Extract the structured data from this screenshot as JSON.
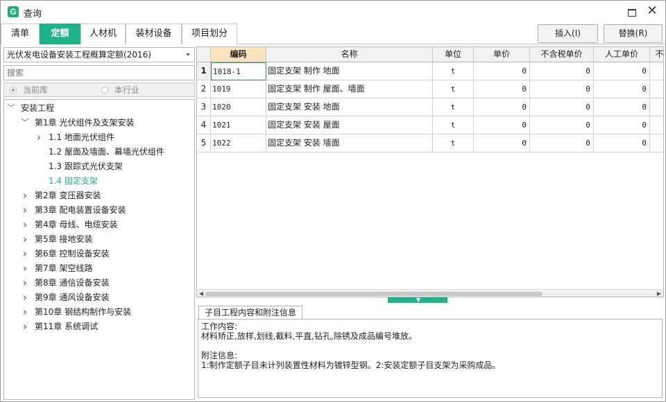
{
  "window": {
    "title": "查询",
    "app_icon_letter": "G"
  },
  "tabs": [
    {
      "label": "清单",
      "active": false
    },
    {
      "label": "定额",
      "active": true
    },
    {
      "label": "人材机",
      "active": false
    },
    {
      "label": "装材设备",
      "active": false
    },
    {
      "label": "项目划分",
      "active": false
    }
  ],
  "toolbar": {
    "insert_label": "插入(I)",
    "replace_label": "替换(R)"
  },
  "left": {
    "library_select": "光伏发电设备安装工程概算定额(2016)",
    "search_placeholder": "搜索",
    "radio_current": "当前库",
    "radio_industry": "本行业"
  },
  "tree": [
    {
      "label": "安装工程",
      "level": 0,
      "chevron": "v",
      "selected": false
    },
    {
      "label": "第1章  光伏组件及支架安装",
      "level": 1,
      "chevron": "v",
      "selected": false
    },
    {
      "label": "1.1 地面光伏组件",
      "level": 2,
      "chevron": ">",
      "selected": false
    },
    {
      "label": "1.2 屋面及墙面、幕墙光伏组件",
      "level": 2,
      "chevron": "",
      "selected": false
    },
    {
      "label": "1.3 跟踪式光伏支架",
      "level": 2,
      "chevron": "",
      "selected": false
    },
    {
      "label": "1.4 固定支架",
      "level": 2,
      "chevron": "",
      "selected": true
    },
    {
      "label": "第2章  变压器安装",
      "level": 1,
      "chevron": ">",
      "selected": false
    },
    {
      "label": "第3章  配电装置设备安装",
      "level": 1,
      "chevron": ">",
      "selected": false
    },
    {
      "label": "第4章  母线、电缆安装",
      "level": 1,
      "chevron": ">",
      "selected": false
    },
    {
      "label": "第5章  接地安装",
      "level": 1,
      "chevron": ">",
      "selected": false
    },
    {
      "label": "第6章  控制设备安装",
      "level": 1,
      "chevron": ">",
      "selected": false
    },
    {
      "label": "第7章  架空线路",
      "level": 1,
      "chevron": ">",
      "selected": false
    },
    {
      "label": "第8章  通信设备安装",
      "level": 1,
      "chevron": ">",
      "selected": false
    },
    {
      "label": "第9章  通风设备安装",
      "level": 1,
      "chevron": ">",
      "selected": false
    },
    {
      "label": "第10章  钢结构制作与安装",
      "level": 1,
      "chevron": ">",
      "selected": false
    },
    {
      "label": "第11章  系统调试",
      "level": 1,
      "chevron": ">",
      "selected": false
    }
  ],
  "table": {
    "columns": [
      "",
      "编码",
      "名称",
      "单位",
      "单价",
      "不含税单价",
      "人工单价",
      "不含"
    ],
    "rows": [
      {
        "num": "1",
        "code": "1018-1",
        "name": "固定支架 制作 地面",
        "unit": "t",
        "price": "0",
        "price_ex_tax": "0",
        "labor": "0"
      },
      {
        "num": "2",
        "code": "1019",
        "name": "固定支架 制作 屋面、墙面",
        "unit": "t",
        "price": "0",
        "price_ex_tax": "0",
        "labor": "0"
      },
      {
        "num": "3",
        "code": "1020",
        "name": "固定支架 安装 地面",
        "unit": "t",
        "price": "0",
        "price_ex_tax": "0",
        "labor": "0"
      },
      {
        "num": "4",
        "code": "1021",
        "name": "固定支架 安装 屋面",
        "unit": "t",
        "price": "0",
        "price_ex_tax": "0",
        "labor": "0"
      },
      {
        "num": "5",
        "code": "1022",
        "name": "固定支架 安装 墙面",
        "unit": "t",
        "price": "0",
        "price_ex_tax": "0",
        "labor": "0"
      }
    ]
  },
  "info": {
    "tab_label": "子目工程内容和附注信息",
    "work_title": "工作内容:",
    "work_text": "材料矫正,放样,划线,截料,平直,钻孔,除锈及成品编号堆放。",
    "note_title": "附注信息:",
    "note_text": "1:制作定额子目未计列装置性材料为镀锌型钢。2:安装定额子目支架为采购成品。"
  },
  "colors": {
    "accent": "#1fb38a",
    "sorted_header": "#fde4bf"
  }
}
